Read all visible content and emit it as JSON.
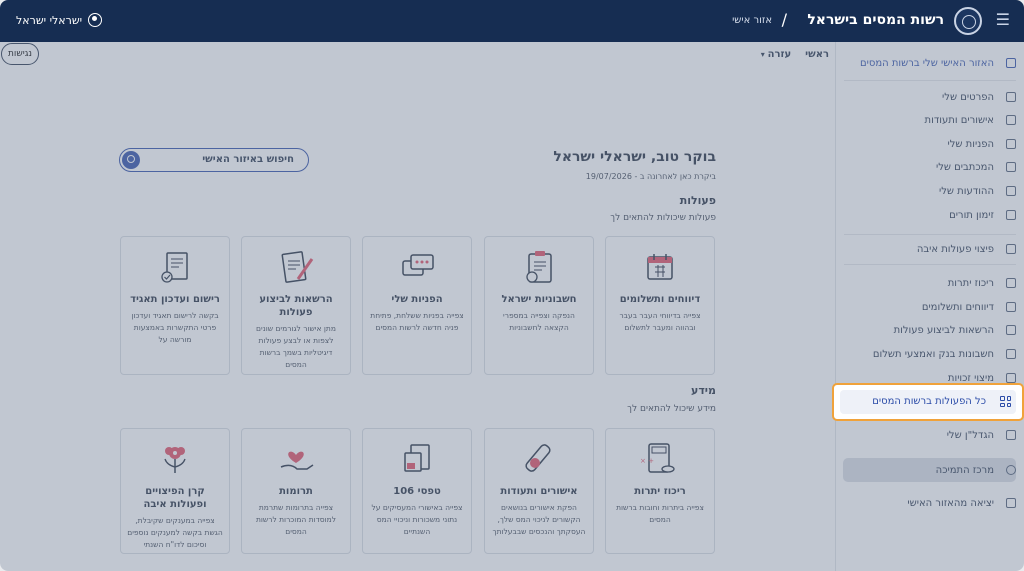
{
  "topbar": {
    "brand": "רשות המסים בישראל",
    "area": "אזור אישי",
    "user_name": "ישראלי ישראל"
  },
  "sidebar": {
    "home": "האזור האישי שלי ברשות המסים",
    "items": [
      {
        "label": "הפרטים שלי",
        "icon": "person-icon"
      },
      {
        "label": "אישורים ותעודות",
        "icon": "document-icon"
      },
      {
        "label": "הפניות שלי",
        "icon": "chat-icon"
      },
      {
        "label": "המכתבים שלי",
        "icon": "mail-icon"
      },
      {
        "label": "ההודעות שלי",
        "icon": "message-icon"
      },
      {
        "label": "זימון תורים",
        "icon": "calendar-icon"
      }
    ],
    "items2": [
      {
        "label": "פיצוי פעולות איבה",
        "icon": "flag-icon"
      }
    ],
    "items3": [
      {
        "label": "ריכוז יתרות",
        "icon": "database-icon"
      },
      {
        "label": "דיווחים ותשלומים",
        "icon": "calendar-icon"
      },
      {
        "label": "הרשאות לביצוע פעולות",
        "icon": "people-icon"
      },
      {
        "label": "חשבונות בנק ואמצעי תשלום",
        "icon": "card-icon"
      },
      {
        "label": "מיצוי זכויות",
        "icon": "heart-icon"
      }
    ],
    "all_actions": "כל הפעולות ברשות המסים",
    "mygadal": "הגדל\"ן שלי",
    "support": "מרכז התמיכה",
    "exit": "יציאה מהאזור האישי"
  },
  "main": {
    "crumb_home": "ראשי",
    "crumb_help": "עזרה",
    "accessibility": "נגישות",
    "greeting": "בוקר טוב, ישראלי ישראל",
    "last_visit": "ביקרת כאן לאחרונה ב - 19/07/2026",
    "search_label": "חיפוש באיזור האישי",
    "actions_title": "פעולות",
    "actions_sub": "פעולות שיכולות להתאים לך",
    "info_title": "מידע",
    "info_sub": "מידע שיכול להתאים לך",
    "action_cards": [
      {
        "title": "דיווחים ותשלומים",
        "desc": "צפייה בדיווחי העבר בעבר ובהווה ומעבר לתשלום",
        "icon": "calendar-icon"
      },
      {
        "title": "חשבוניות ישראל",
        "desc": "הנפקה וצפייה במספרי הקצאה לחשבוניות",
        "icon": "clipboard-icon"
      },
      {
        "title": "הפניות שלי",
        "desc": "צפייה בפניות ששלחת, פתיחת פניה חדשה לרשות המסים",
        "icon": "chat-icon"
      },
      {
        "title": "הרשאות לביצוע פעולות",
        "desc": "מתן אישור לגורמים שונים לצפות או לבצע פעולות דיגיטליות בשמך ברשות המסים",
        "icon": "contract-icon"
      },
      {
        "title": "רישום ועדכון תאגיד",
        "desc": "בקשה לרישום תאגיד ועדכון פרטי התקשרות באמצעות מורשה על",
        "icon": "signature-icon"
      }
    ],
    "info_cards": [
      {
        "title": "ריכוז יתרות",
        "desc": "צפייה ביתרות וחובות ברשות המסים",
        "icon": "calculator-icon"
      },
      {
        "title": "אישורים ותעודות",
        "desc": "הפקת אישורים בנושאים הקשורים לניכוי המס שלך, העסקתך והנכסים שבבעלותך",
        "icon": "certificate-icon"
      },
      {
        "title": "טפסי 106",
        "desc": "צפייה באישורי המעסיקים על נתוני משכורות וניכויי המס השנתיים",
        "icon": "forms-icon"
      },
      {
        "title": "תרומות",
        "desc": "צפייה בתרומות שתרמת למוסדות המוכרות לרשות המסים",
        "icon": "donation-icon"
      },
      {
        "title": "קרן הפיצויים ופעולות איבה",
        "desc": "צפייה במענקים שקיבלת, הגשת בקשה למענקים נוספים וסיכום לדו\"ח השנתי",
        "icon": "flower-icon"
      }
    ]
  },
  "colors": {
    "topbar": "#162d52",
    "accent": "#2b4ca8",
    "highlight": "#f0a23a"
  }
}
